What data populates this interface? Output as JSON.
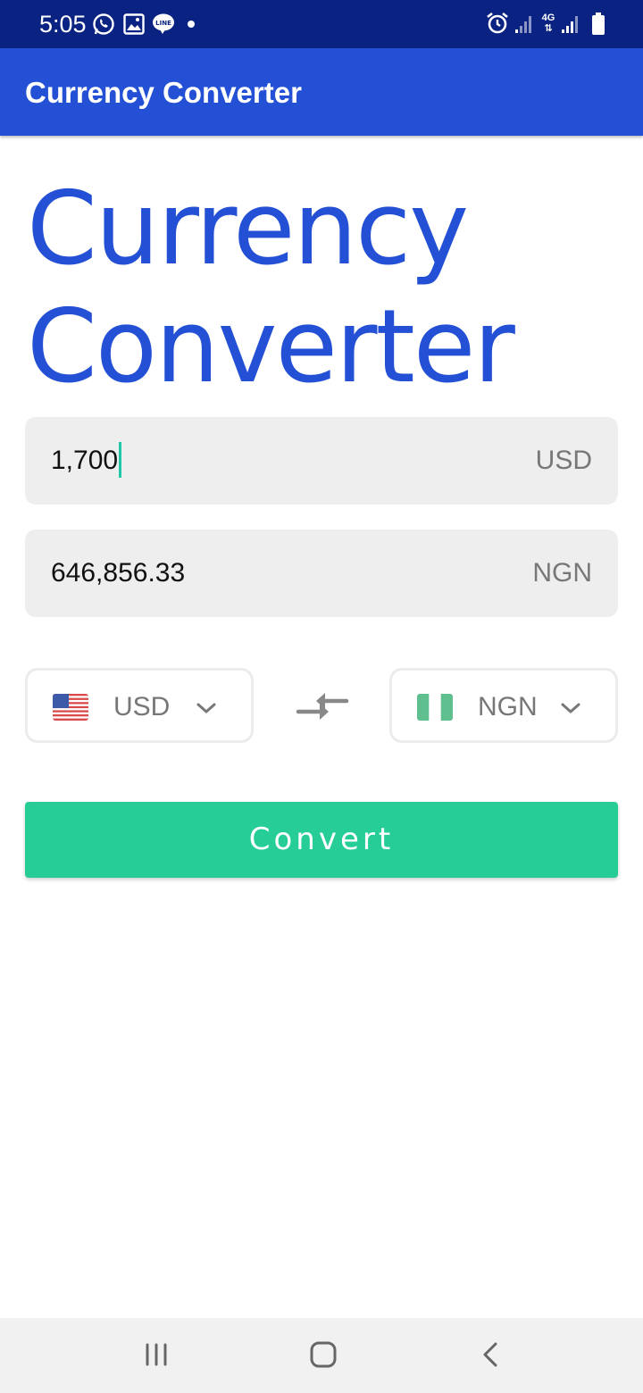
{
  "status_bar": {
    "time": "5:05",
    "icons": [
      "whatsapp-icon",
      "gallery-icon",
      "line-icon",
      "dot-icon",
      "alarm-icon",
      "signal-icon",
      "4g-icon",
      "signal-icon",
      "battery-icon"
    ],
    "network_label": "4G"
  },
  "app_bar": {
    "title": "Currency Converter"
  },
  "heading": {
    "line1": "Currency",
    "line2": "Converter"
  },
  "from_field": {
    "value": "1,700",
    "currency": "USD"
  },
  "to_field": {
    "value": "646,856.33",
    "currency": "NGN"
  },
  "from_selector": {
    "flag": "us-flag-icon",
    "code": "USD",
    "icon": "chevron-down-icon"
  },
  "to_selector": {
    "flag": "nigeria-flag-icon",
    "code": "NGN",
    "icon": "chevron-down-icon"
  },
  "swap": {
    "icon": "swap-arrows-icon"
  },
  "convert_button": {
    "label": "Convert"
  },
  "nav_bar": {
    "icons": [
      "recent-apps-icon",
      "home-icon",
      "back-icon"
    ]
  },
  "colors": {
    "status_bar": "#0a2382",
    "app_bar": "#2350d4",
    "heading": "#2350d4",
    "field_bg": "#eeeeee",
    "button": "#26cd97",
    "caret": "#1fc8a8"
  }
}
